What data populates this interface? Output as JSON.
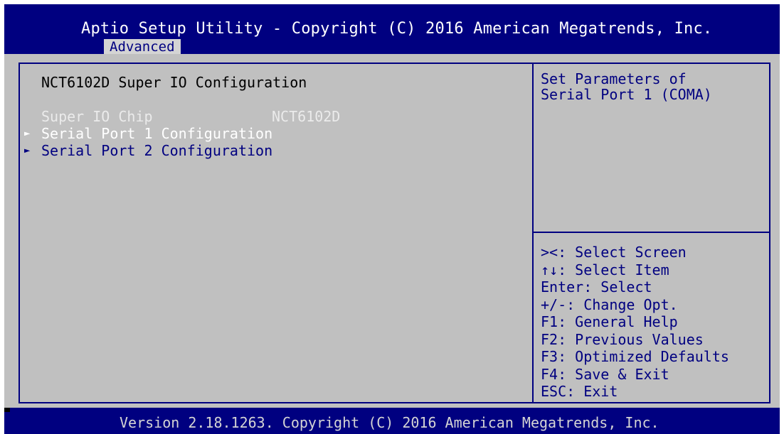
{
  "header": {
    "title": "Aptio Setup Utility - Copyright (C) 2016 American Megatrends, Inc.",
    "active_tab": "Advanced"
  },
  "main": {
    "section_title": "NCT6102D Super IO Configuration",
    "items": [
      {
        "label": "Super IO Chip",
        "value": "NCT6102D",
        "type": "info",
        "arrow": ""
      },
      {
        "label": "Serial Port 1 Configuration",
        "value": "",
        "type": "submenu",
        "arrow": "►"
      },
      {
        "label": "Serial Port 2 Configuration",
        "value": "",
        "type": "submenu",
        "arrow": "►"
      }
    ]
  },
  "help": {
    "text": "Set Parameters of\nSerial Port 1 (COMA)"
  },
  "keys": [
    "><: Select Screen",
    "↑↓: Select Item",
    "Enter: Select",
    "+/-: Change Opt.",
    "F1: General Help",
    "F2: Previous Values",
    "F3: Optimized Defaults",
    "F4: Save & Exit",
    "ESC: Exit"
  ],
  "footer": {
    "version_text": "Version 2.18.1263. Copyright (C) 2016 American Megatrends, Inc."
  },
  "colors": {
    "bios_blue": "#000080",
    "panel_grey": "#c0c0c0",
    "selected_text": "#ffffff",
    "disabled_text": "#ebebeb"
  }
}
